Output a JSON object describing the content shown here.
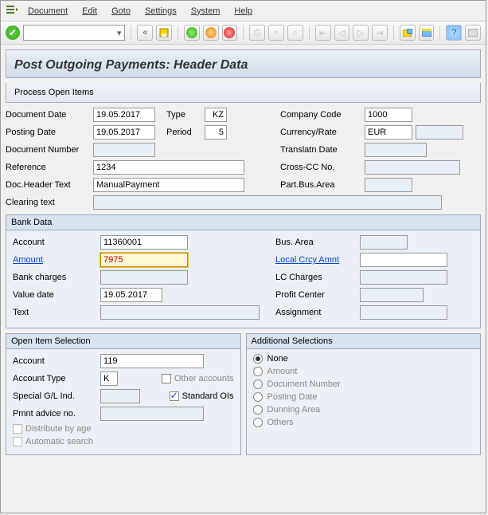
{
  "menu": {
    "document": "Document",
    "edit": "Edit",
    "goto": "Goto",
    "settings": "Settings",
    "system": "System",
    "help": "Help"
  },
  "title": "Post Outgoing Payments: Header Data",
  "subbar": {
    "process": "Process Open Items"
  },
  "header": {
    "doc_date_lbl": "Document Date",
    "doc_date": "19.05.2017",
    "type_lbl": "Type",
    "type": "KZ",
    "company_code_lbl": "Company Code",
    "company_code": "1000",
    "posting_date_lbl": "Posting Date",
    "posting_date": "19.05.2017",
    "period_lbl": "Period",
    "period": "5",
    "currency_lbl": "Currency/Rate",
    "currency": "EUR",
    "docnum_lbl": "Document Number",
    "docnum": "",
    "transl_lbl": "Translatn Date",
    "ref_lbl": "Reference",
    "ref": "1234",
    "crosscc_lbl": "Cross-CC No.",
    "htext_lbl": "Doc.Header Text",
    "htext": "ManualPayment",
    "partbus_lbl": "Part.Bus.Area",
    "clearing_lbl": "Clearing text",
    "clearing": ""
  },
  "bank": {
    "title": "Bank Data",
    "account_lbl": "Account",
    "account": "11360001",
    "busarea_lbl": "Bus. Area",
    "amount_lbl": "Amount",
    "amount": "7975",
    "local_amt_lbl": "Local Crcy Amnt",
    "bankcharges_lbl": "Bank charges",
    "lccharges_lbl": "LC Charges",
    "valuedate_lbl": "Value date",
    "valuedate": "19.05.2017",
    "profitcenter_lbl": "Profit Center",
    "text_lbl": "Text",
    "assignment_lbl": "Assignment"
  },
  "openitem": {
    "title": "Open Item Selection",
    "account_lbl": "Account",
    "account": "119",
    "accttype_lbl": "Account Type",
    "accttype": "K",
    "other_accts": "Other accounts",
    "sgl_lbl": "Special G/L Ind.",
    "std_oi": "Standard OIs",
    "pmnt_lbl": "Pmnt advice no.",
    "dist": "Distribute by age",
    "auto": "Automatic search"
  },
  "addsel": {
    "title": "Additional Selections",
    "none": "None",
    "amount": "Amount",
    "docnum": "Document Number",
    "postdate": "Posting Date",
    "dunning": "Dunning Area",
    "others": "Others"
  }
}
